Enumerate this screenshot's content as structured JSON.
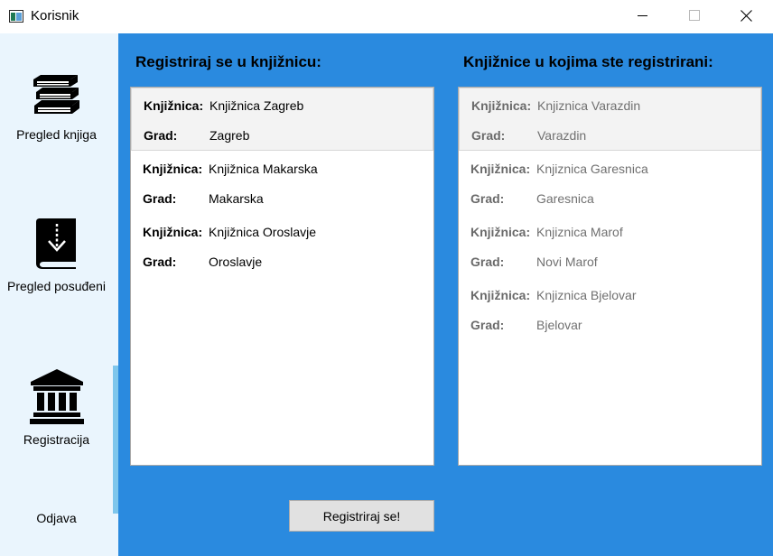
{
  "window": {
    "title": "Korisnik"
  },
  "sidebar": {
    "items": [
      {
        "label": "Pregled knjiga",
        "icon": "books-icon"
      },
      {
        "label": "Pregled posuđeni",
        "icon": "download-book-icon"
      },
      {
        "label": "Registracija",
        "icon": "library-building-icon"
      },
      {
        "label": "Odjava"
      }
    ]
  },
  "main": {
    "left_heading": "Registriraj se u knjižnicu:",
    "right_heading": "Knjižnice u kojima ste registrirani:",
    "field_labels": {
      "library": "Knjižnica:",
      "city": "Grad:"
    },
    "available_libraries": [
      {
        "library": "Knjižnica Zagreb",
        "city": "Zagreb"
      },
      {
        "library": "Knjižnica Makarska",
        "city": "Makarska"
      },
      {
        "library": "Knjižnica Oroslavje",
        "city": "Oroslavje"
      }
    ],
    "registered_libraries": [
      {
        "library": "Knjiznica Varazdin",
        "city": "Varazdin"
      },
      {
        "library": "Knjiznica Garesnica",
        "city": "Garesnica"
      },
      {
        "library": "Knjiznica Marof",
        "city": "Novi Marof"
      },
      {
        "library": "Knjiznica Bjelovar",
        "city": "Bjelovar"
      }
    ],
    "register_button": "Registriraj se!"
  },
  "colors": {
    "main_background": "#2a8adf",
    "sidebar_background": "#eaf5fd",
    "sidebar_accent": "#7ec6ec",
    "selected_row": "#f3f3f3",
    "muted_text": "#707070"
  }
}
